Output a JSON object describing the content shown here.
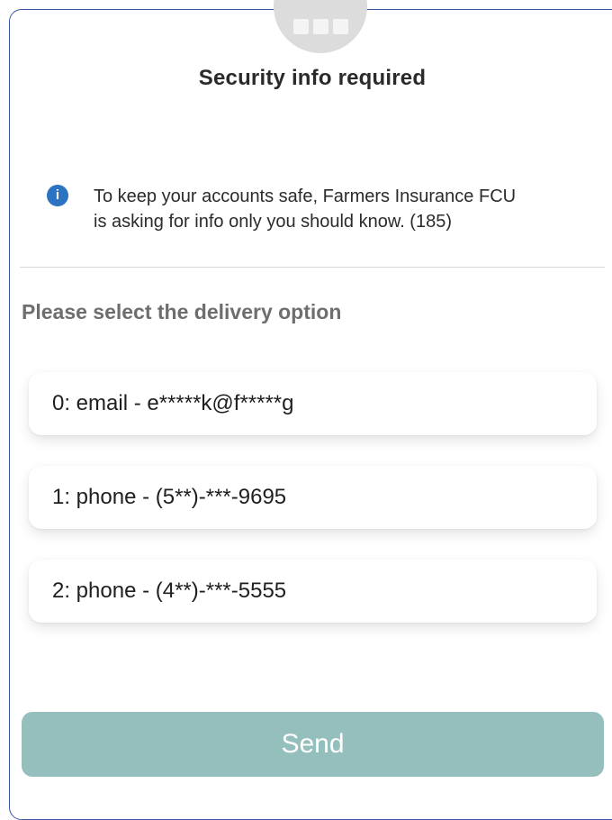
{
  "header": {
    "title": "Security info required"
  },
  "notice": {
    "icon": "info-icon",
    "icon_glyph": "i",
    "icon_color": "#2c73c2",
    "text_line1": "To keep your accounts safe, Farmers Insurance FCU",
    "text_line2": "is asking for info only you should know. (185)"
  },
  "delivery": {
    "label": "Please select the delivery option",
    "options": [
      {
        "label": "0: email - e*****k@f*****g"
      },
      {
        "label": "1: phone - (5**)-***-9695"
      },
      {
        "label": "2: phone - (4**)-***-5555"
      }
    ]
  },
  "actions": {
    "send_label": "Send",
    "send_color": "#95bfbd"
  }
}
